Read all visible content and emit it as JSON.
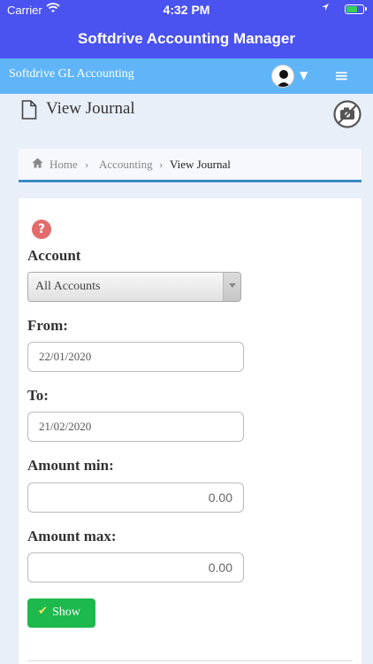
{
  "status_bar": {
    "carrier": "Carrier",
    "time": "4:32 PM"
  },
  "app_title": "Softdrive Accounting Manager",
  "navbar": {
    "brand": "Softdrive GL Accounting"
  },
  "page": {
    "title": "View Journal"
  },
  "breadcrumb": {
    "home": "Home",
    "accounting": "Accounting",
    "current": "View Journal"
  },
  "form": {
    "account_label": "Account",
    "account_value": "All Accounts",
    "from_label": "From:",
    "from_value": "22/01/2020",
    "to_label": "To:",
    "to_value": "21/02/2020",
    "amount_min_label": "Amount min:",
    "amount_min_value": "0.00",
    "amount_max_label": "Amount max:",
    "amount_max_value": "0.00",
    "show_label": "Show"
  },
  "colors": {
    "header": "#4a52f0",
    "navbar": "#5fb5f8",
    "show_button": "#1db94c",
    "help_icon": "#e46b6b"
  }
}
